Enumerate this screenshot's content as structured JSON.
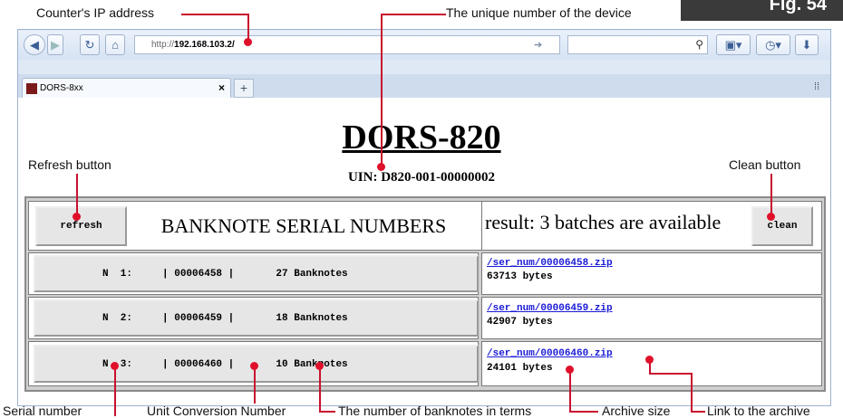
{
  "figure_tab": "Fig. 54",
  "annotations": {
    "ip": "Counter's IP address",
    "unique": "The unique number of the device",
    "refresh": "Refresh button",
    "clean": "Clean button",
    "serial": "Serial number",
    "unit": "Unit Conversion Number",
    "count": "The number of banknotes in terms",
    "archive_size": "Archive size",
    "link": "Link to the archive"
  },
  "browser": {
    "url_prefix": "http://",
    "url_host": "192.168.103.2",
    "url_suffix": "/",
    "tab_title": "DORS-8xx",
    "tab_close": "×",
    "new_tab": "+"
  },
  "page": {
    "title": "DORS-820",
    "uin": "UIN: D820-001-00000002",
    "refresh_label": "refresh",
    "header": "BANKNOTE SERIAL NUMBERS",
    "result": "result: 3 batches are available",
    "clean_label": "clean",
    "rows": [
      {
        "label": "N  1:     | 00006458 |       27 Banknotes",
        "link": "/ser_num/00006458.zip",
        "size": "63713 bytes"
      },
      {
        "label": "N  2:     | 00006459 |       18 Banknotes",
        "link": "/ser_num/00006459.zip",
        "size": "42907 bytes"
      },
      {
        "label": "N  3:     | 00006460 |       10 Banknotes",
        "link": "/ser_num/00006460.zip",
        "size": "24101 bytes"
      }
    ]
  },
  "colors": {
    "annotation_line": "#c8102e",
    "link": "#1a1ad6"
  }
}
